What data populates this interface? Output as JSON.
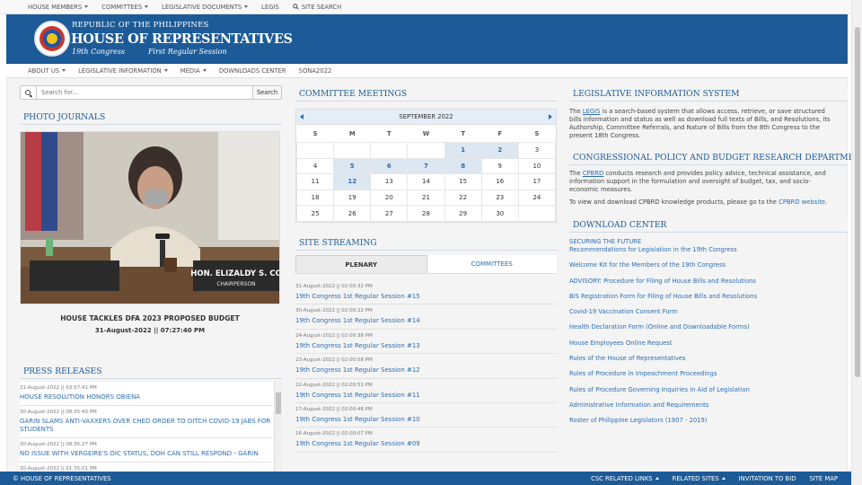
{
  "topnav": {
    "items": [
      {
        "label": "HOUSE MEMBERS",
        "dropdown": true
      },
      {
        "label": "COMMITTEES",
        "dropdown": true
      },
      {
        "label": "LEGISLATIVE DOCUMENTS",
        "dropdown": true
      },
      {
        "label": "LEGIS"
      },
      {
        "label": "SITE SEARCH",
        "icon": "search-icon"
      }
    ]
  },
  "banner": {
    "line1": "REPUBLIC OF THE PHILIPPINES",
    "title": "HOUSE OF REPRESENTATIVES",
    "congress": "19th Congress",
    "session": "First Regular Session",
    "color": "#1d5b98"
  },
  "secnav": {
    "items": [
      {
        "label": "ABOUT US",
        "dropdown": true
      },
      {
        "label": "LEGISLATIVE INFORMATION",
        "dropdown": true
      },
      {
        "label": "MEDIA",
        "dropdown": true
      },
      {
        "label": "DOWNLOADS CENTER"
      },
      {
        "label": "SONA2022"
      }
    ]
  },
  "search": {
    "placeholder": "Search for...",
    "button": "Search"
  },
  "photo_journals": {
    "heading": "PHOTO JOURNALS",
    "photo_label": "HON. ELIZALDY S. CO",
    "photo_sublabel": "CHAIRPERSON",
    "caption": "HOUSE TACKLES DFA 2023 PROPOSED BUDGET",
    "date": "31-August-2022 || 07:27:40 PM"
  },
  "press_releases": {
    "heading": "PRESS RELEASES",
    "items": [
      {
        "date": "31-August-2022 || 03:57:41 PM",
        "title": "HOUSE RESOLUTION HONORS OBIENA"
      },
      {
        "date": "30-August-2022 || 08:35:43 PM",
        "title": "GARIN SLAMS ANTI-VAXXERS OVER CHED ORDER TO DITCH COVID-19 JABS FOR STUDENTS"
      },
      {
        "date": "30-August-2022 || 08:35:27 PM",
        "title": "NO ISSUE WITH VERGEIRE'S OIC STATUS, DOH CAN STILL RESPOND - GARIN"
      },
      {
        "date": "30-August-2022 || 01:35:01 PM",
        "title": ""
      }
    ]
  },
  "committee_meetings": {
    "heading": "COMMITTEE MEETINGS",
    "month": "SEPTEMBER 2022",
    "weekdays": [
      "S",
      "M",
      "T",
      "W",
      "T",
      "F",
      "S"
    ],
    "weeks": [
      [
        "",
        "",
        "",
        "",
        "1",
        "2",
        "3"
      ],
      [
        "4",
        "5",
        "6",
        "7",
        "8",
        "9",
        "10"
      ],
      [
        "11",
        "12",
        "13",
        "14",
        "15",
        "16",
        "17"
      ],
      [
        "18",
        "19",
        "20",
        "21",
        "22",
        "23",
        "24"
      ],
      [
        "25",
        "26",
        "27",
        "28",
        "29",
        "30",
        ""
      ]
    ],
    "event_days": [
      "1",
      "2",
      "5",
      "6",
      "7",
      "8",
      "12"
    ]
  },
  "site_streaming": {
    "heading": "SITE STREAMING",
    "tabs": [
      "PLENARY",
      "COMMITTEES"
    ],
    "active_tab": "PLENARY",
    "items": [
      {
        "date": "31-August-2022 || 02:00:32 PM",
        "title": "19th Congress 1st Regular Session #15"
      },
      {
        "date": "30-August-2022 || 02:00:22 PM",
        "title": "19th Congress 1st Regular Session #14"
      },
      {
        "date": "24-August-2022 || 02:00:38 PM",
        "title": "19th Congress 1st Regular Session #13"
      },
      {
        "date": "23-August-2022 || 02:00:58 PM",
        "title": "19th Congress 1st Regular Session #12"
      },
      {
        "date": "22-August-2022 || 02:00:51 PM",
        "title": "19th Congress 1st Regular Session #11"
      },
      {
        "date": "17-August-2022 || 02:00:46 PM",
        "title": "19th Congress 1st Regular Session #10"
      },
      {
        "date": "16-August-2022 || 02:00:07 PM",
        "title": "19th Congress 1st Regular Session #09"
      }
    ]
  },
  "legis": {
    "heading": "LEGISLATIVE INFORMATION SYSTEM",
    "pre": "The ",
    "link": "LEGIS",
    "text": " is a search-based system that allows access, retrieve, or save structured bills information and status as well as download full texts of Bills, and Resolutions, its Authorship, Committee Referrals, and Nature of Bills from the 8th Congress to the present 18th Congress."
  },
  "cpbrd": {
    "heading": "CONGRESSIONAL POLICY AND BUDGET RESEARCH DEPARTMENT",
    "pre": "The ",
    "link": "CPBRD",
    "text": " conducts research and provides policy advice, technical assistance, and information support in the formulation and oversight of budget, tax, and socio-economic measures.",
    "text2": "To view and download CPBRD knowledge products, please go to the ",
    "link2": "CPBRD website",
    "end2": "."
  },
  "download_center": {
    "heading": "DOWNLOAD CENTER",
    "items": [
      {
        "line1": "SECURING THE FUTURE",
        "line2": "Recommendations for Legislation in the 19th Congress"
      },
      {
        "line1": "Welcome Kit for the Members of the 19th Congress"
      },
      {
        "line1": "ADVISORY: Procedure for Filing of House Bills and Resolutions"
      },
      {
        "line1": "BIS Registration Form for Filing of House Bills and Resolutions"
      },
      {
        "line1": "Covid-19 Vaccination Consent Form"
      },
      {
        "line1": "Health Declaration Form (Online and Downloadable Forms)"
      },
      {
        "line1": "House Employees Online Request"
      },
      {
        "line1": "Rules of the House of Representatives"
      },
      {
        "line1": "Rules of Procedure in Impeachment Proceedings"
      },
      {
        "line1": "Rules of Procedure Governing Inquiries in Aid of Legislation"
      },
      {
        "line1": "Administrative Information and Requirements"
      },
      {
        "line1": "Roster of Philippine Legislators (1907 - 2019)"
      }
    ]
  },
  "footer": {
    "copyright": "© HOUSE OF REPRESENTATIVES",
    "links": [
      {
        "label": "CSC RELATED LINKS",
        "dropdown": true
      },
      {
        "label": "RELATED SITES",
        "dropdown": true
      },
      {
        "label": "INVITATION TO BID"
      },
      {
        "label": "SITE MAP"
      }
    ]
  }
}
